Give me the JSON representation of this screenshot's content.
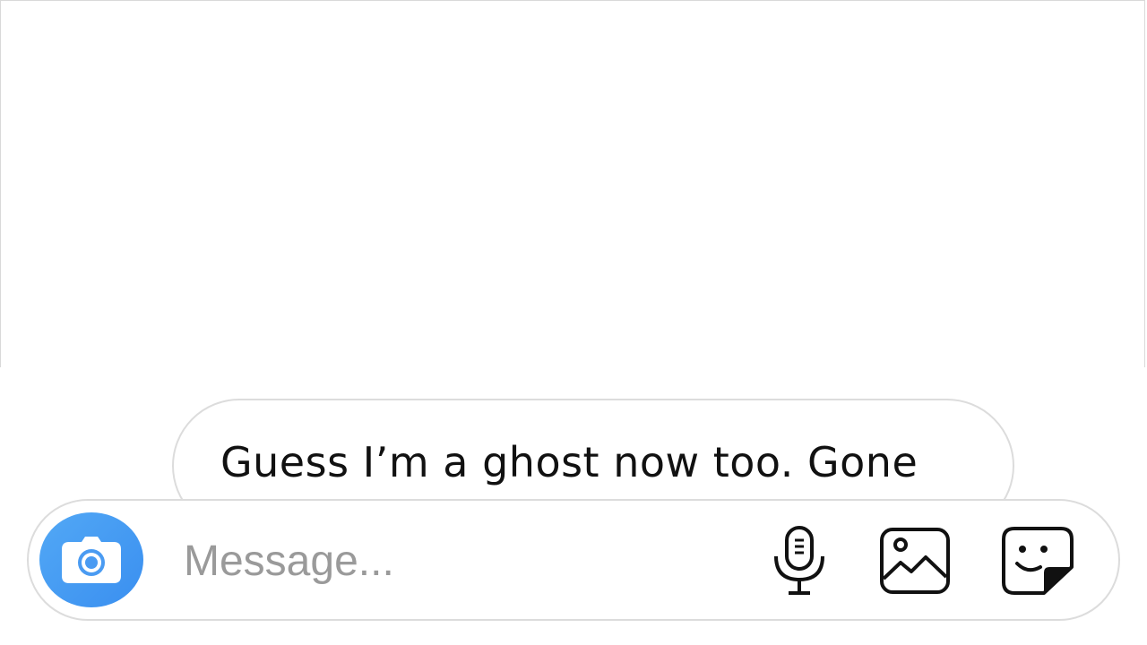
{
  "conversation": {
    "message_text": "Guess I’m a ghost now too. Gone"
  },
  "composer": {
    "placeholder": "Message...",
    "icons": {
      "camera": "camera-icon",
      "microphone": "microphone-icon",
      "gallery": "gallery-icon",
      "sticker": "sticker-icon"
    }
  },
  "colors": {
    "accent": "#3a8ff0",
    "placeholder": "#9a9a9a",
    "border": "#dcdcdc"
  }
}
